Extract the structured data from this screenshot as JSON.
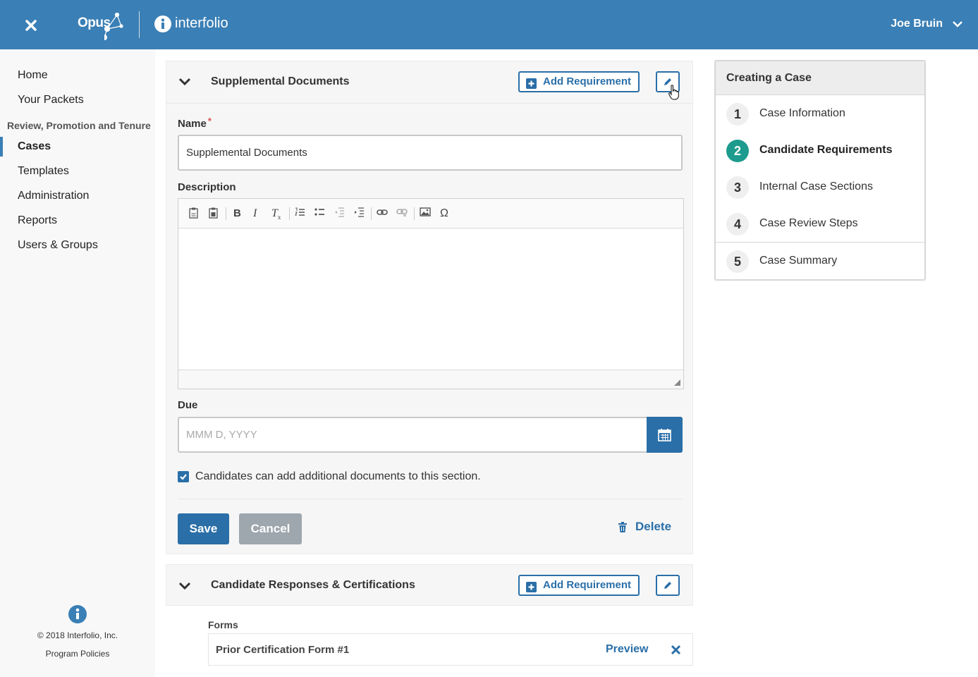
{
  "header": {
    "app_name": "Opus",
    "brand": "interfolio",
    "user_name": "Joe Bruin"
  },
  "sidebar": {
    "items_top": [
      {
        "label": "Home"
      },
      {
        "label": "Your Packets"
      }
    ],
    "group_label": "Review, Promotion and Tenure",
    "items": [
      {
        "label": "Cases",
        "active": true
      },
      {
        "label": "Templates"
      },
      {
        "label": "Administration"
      },
      {
        "label": "Reports"
      },
      {
        "label": "Users & Groups"
      }
    ],
    "copyright": "© 2018 Interfolio, Inc.",
    "policies": "Program Policies"
  },
  "section1": {
    "title": "Supplemental Documents",
    "add_label": "Add Requirement",
    "name_label": "Name",
    "required_mark": "*",
    "name_value": "Supplemental Documents",
    "description_label": "Description",
    "due_label": "Due",
    "due_placeholder": "MMM D, YYYY",
    "checkbox_label": "Candidates can add additional documents to this section.",
    "checkbox_checked": true,
    "save_label": "Save",
    "cancel_label": "Cancel",
    "delete_label": "Delete"
  },
  "editor_toolbar": [
    "paste-icon",
    "paste-word-icon",
    "bold-icon",
    "italic-icon",
    "remove-format-icon",
    "numbered-list-icon",
    "bulleted-list-icon",
    "outdent-icon",
    "indent-icon",
    "link-icon",
    "unlink-icon",
    "image-icon",
    "special-char-icon"
  ],
  "section2": {
    "title": "Candidate Responses & Certifications",
    "add_label": "Add Requirement",
    "forms_label": "Forms",
    "forms": [
      {
        "name": "Prior Certification Form #1",
        "preview_label": "Preview"
      }
    ]
  },
  "steps": {
    "title": "Creating a Case",
    "items": [
      {
        "num": "1",
        "label": "Case Information"
      },
      {
        "num": "2",
        "label": "Candidate Requirements",
        "active": true
      },
      {
        "num": "3",
        "label": "Internal Case Sections"
      },
      {
        "num": "4",
        "label": "Case Review Steps"
      },
      {
        "num": "5",
        "label": "Case Summary"
      }
    ]
  },
  "colors": {
    "header_bg": "#3a7fb5",
    "accent": "#2a6fa8",
    "active_step": "#1d9b8e"
  }
}
